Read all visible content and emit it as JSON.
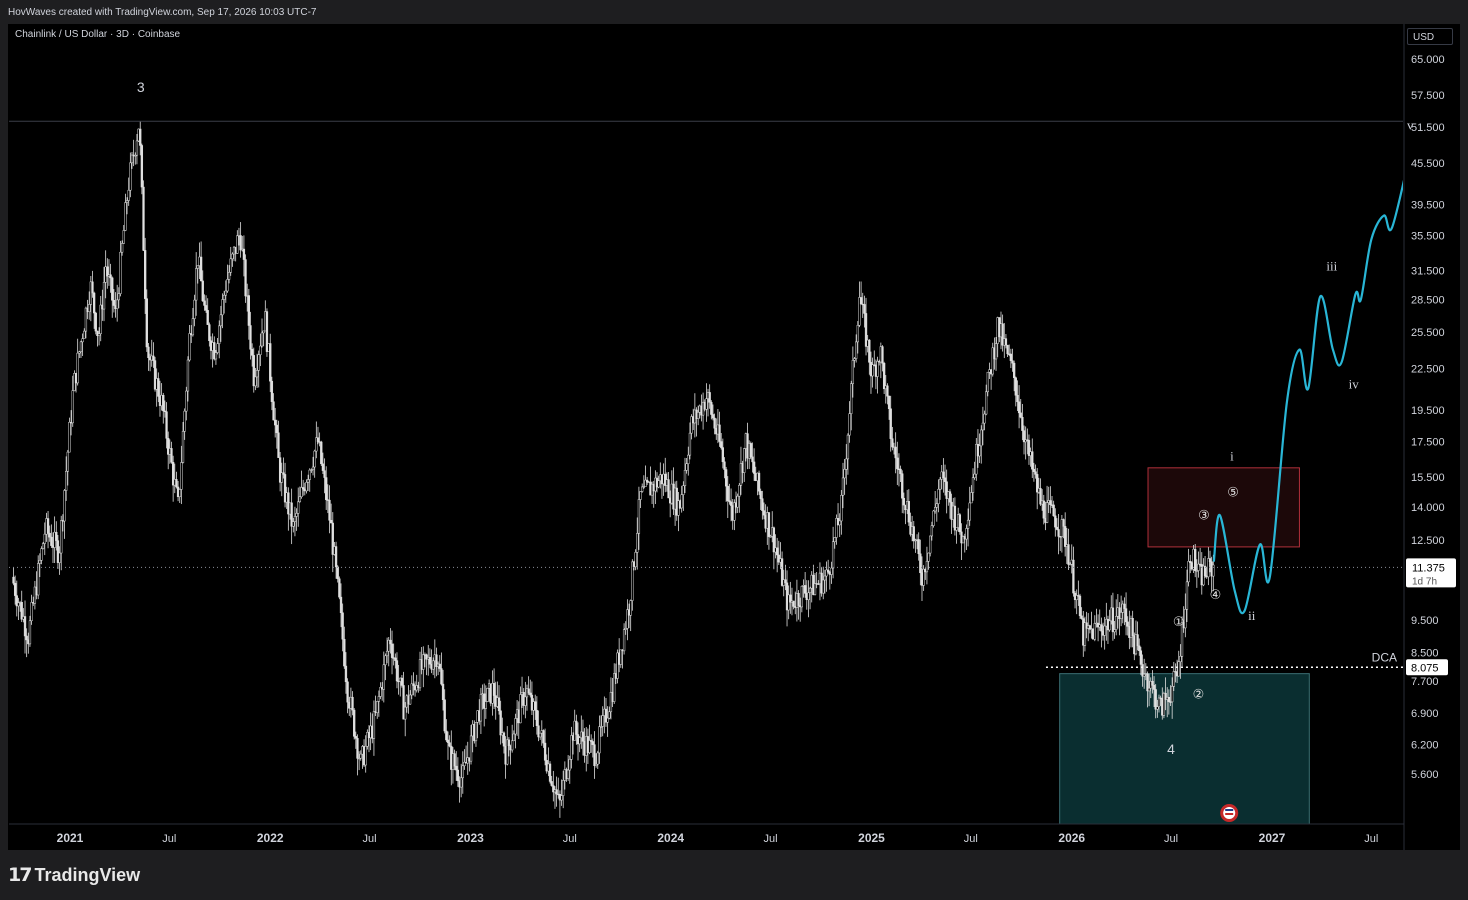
{
  "header": {
    "credit": "HovWaves created with TradingView.com, Sep 17, 2026 10:03 UTC-7"
  },
  "chart_title": "Chainlink / US Dollar · 3D · Coinbase",
  "currency_button": "USD",
  "logo": {
    "text": "TradingView",
    "icon": "tradingview-logo-icon"
  },
  "colors": {
    "background": "#000000",
    "frame": "#1e1e20",
    "candles": "#e0e0e0",
    "projection": "#29b6d6",
    "resistance_box": "#b0303a",
    "support_box": "#0e3d40",
    "text": "#d1d4dc"
  },
  "chart_data": {
    "type": "candlestick",
    "symbol": "Chainlink / US Dollar",
    "interval": "3D",
    "exchange": "Coinbase",
    "y_scale": "log",
    "ylim": [
      4.6,
      72
    ],
    "x_tick_labels": [
      "2021",
      "Jul",
      "2022",
      "Jul",
      "2023",
      "Jul",
      "2024",
      "Jul",
      "2025",
      "Jul",
      "2026",
      "Jul",
      "2027",
      "Jul"
    ],
    "y_tick_labels": [
      "65.000",
      "57.500",
      "51.500",
      "45.500",
      "39.500",
      "35.500",
      "31.500",
      "28.500",
      "25.500",
      "22.500",
      "19.500",
      "17.500",
      "15.500",
      "14.000",
      "12.500",
      "9.500",
      "8.500",
      "7.700",
      "6.900",
      "6.200",
      "5.600"
    ],
    "price_path": [
      [
        "2020-09-20",
        11.0
      ],
      [
        "2020-10-20",
        9.0
      ],
      [
        "2020-11-20",
        13.0
      ],
      [
        "2020-12-15",
        12.0
      ],
      [
        "2021-01-10",
        21.0
      ],
      [
        "2021-02-10",
        30.0
      ],
      [
        "2021-02-25",
        25.0
      ],
      [
        "2021-03-10",
        32.0
      ],
      [
        "2021-03-28",
        27.0
      ],
      [
        "2021-04-20",
        42.0
      ],
      [
        "2021-05-10",
        52.5
      ],
      [
        "2021-05-25",
        24.0
      ],
      [
        "2021-06-20",
        20.0
      ],
      [
        "2021-07-20",
        14.0
      ],
      [
        "2021-08-10",
        25.0
      ],
      [
        "2021-08-25",
        33.0
      ],
      [
        "2021-09-10",
        26.0
      ],
      [
        "2021-09-25",
        24.0
      ],
      [
        "2021-10-15",
        30.0
      ],
      [
        "2021-11-10",
        36.0
      ],
      [
        "2021-12-05",
        22.0
      ],
      [
        "2021-12-25",
        27.0
      ],
      [
        "2022-01-20",
        16.0
      ],
      [
        "2022-02-15",
        13.0
      ],
      [
        "2022-03-10",
        15.5
      ],
      [
        "2022-04-01",
        17.5
      ],
      [
        "2022-04-25",
        13.0
      ],
      [
        "2022-05-10",
        10.0
      ],
      [
        "2022-05-25",
        7.5
      ],
      [
        "2022-06-18",
        5.8
      ],
      [
        "2022-07-15",
        6.8
      ],
      [
        "2022-08-10",
        9.0
      ],
      [
        "2022-09-05",
        7.0
      ],
      [
        "2022-10-05",
        8.0
      ],
      [
        "2022-11-05",
        8.5
      ],
      [
        "2022-11-25",
        6.0
      ],
      [
        "2022-12-20",
        5.5
      ],
      [
        "2023-01-20",
        7.0
      ],
      [
        "2023-02-15",
        7.5
      ],
      [
        "2023-03-10",
        6.0
      ],
      [
        "2023-04-15",
        7.5
      ],
      [
        "2023-05-10",
        6.5
      ],
      [
        "2023-06-15",
        5.0
      ],
      [
        "2023-07-10",
        6.5
      ],
      [
        "2023-08-20",
        6.0
      ],
      [
        "2023-09-20",
        7.5
      ],
      [
        "2023-10-20",
        10.0
      ],
      [
        "2023-11-10",
        14.5
      ],
      [
        "2023-12-20",
        15.5
      ],
      [
        "2024-01-20",
        14.0
      ],
      [
        "2024-02-10",
        18.5
      ],
      [
        "2024-03-10",
        20.5
      ],
      [
        "2024-04-05",
        17.0
      ],
      [
        "2024-04-25",
        13.5
      ],
      [
        "2024-05-20",
        17.5
      ],
      [
        "2024-06-20",
        14.0
      ],
      [
        "2024-07-10",
        12.5
      ],
      [
        "2024-08-05",
        10.0
      ],
      [
        "2024-09-05",
        10.5
      ],
      [
        "2024-10-15",
        11.0
      ],
      [
        "2024-11-10",
        14.0
      ],
      [
        "2024-12-13",
        29.0
      ],
      [
        "2025-01-05",
        22.0
      ],
      [
        "2025-01-20",
        24.0
      ],
      [
        "2025-02-10",
        17.5
      ],
      [
        "2025-03-10",
        14.0
      ],
      [
        "2025-04-07",
        11.0
      ],
      [
        "2025-05-10",
        15.5
      ],
      [
        "2025-06-20",
        12.5
      ],
      [
        "2025-07-20",
        18.0
      ],
      [
        "2025-08-22",
        26.0
      ],
      [
        "2025-09-20",
        22.0
      ],
      [
        "2025-10-15",
        17.0
      ],
      [
        "2025-11-10",
        14.0
      ],
      [
        "2025-12-05",
        13.5
      ],
      [
        "2025-12-25",
        12.5
      ],
      [
        "2026-01-25",
        9.0
      ],
      [
        "2026-03-01",
        9.3
      ],
      [
        "2026-04-10",
        9.8
      ],
      [
        "2026-05-15",
        8.0
      ],
      [
        "2026-06-15",
        7.0
      ],
      [
        "2026-07-15",
        7.8
      ],
      [
        "2026-08-08",
        12.0
      ],
      [
        "2026-08-25",
        11.0
      ],
      [
        "2026-09-17",
        11.375
      ]
    ],
    "projection": [
      [
        "2026-09-17",
        11.6
      ],
      [
        "2026-09-28",
        13.6
      ],
      [
        "2026-10-25",
        10.5
      ],
      [
        "2026-11-12",
        9.8
      ],
      [
        "2026-12-10",
        12.3
      ],
      [
        "2026-12-28",
        11.0
      ],
      [
        "2027-01-28",
        20.0
      ],
      [
        "2027-02-20",
        24.0
      ],
      [
        "2027-03-08",
        21.0
      ],
      [
        "2027-03-30",
        28.8
      ],
      [
        "2027-04-22",
        24.0
      ],
      [
        "2027-05-08",
        23.0
      ],
      [
        "2027-06-02",
        29.0
      ],
      [
        "2027-06-12",
        28.5
      ],
      [
        "2027-07-01",
        35.0
      ],
      [
        "2027-07-24",
        38.0
      ],
      [
        "2027-08-08",
        36.5
      ],
      [
        "2027-09-12",
        48.0
      ]
    ],
    "wave_labels": {
      "primary": [
        {
          "label": "3",
          "x": "2021-05-10",
          "y": 58.0
        },
        {
          "label": "4",
          "x": "2026-07-01",
          "y": 6.0
        }
      ],
      "intermediate": [
        {
          "label": "i",
          "x": "2026-10-20",
          "y": 16.4
        },
        {
          "label": "ii",
          "x": "2026-11-25",
          "y": 9.5
        },
        {
          "label": "iii",
          "x": "2027-04-20",
          "y": 31.5
        },
        {
          "label": "iv",
          "x": "2027-05-30",
          "y": 21.0
        },
        {
          "label": "v",
          "x": "2027-09-10",
          "y": 51.0
        }
      ],
      "minor": [
        {
          "label": "①",
          "x": "2026-07-15",
          "y": 9.3
        },
        {
          "label": "②",
          "x": "2026-08-20",
          "y": 7.25
        },
        {
          "label": "③",
          "x": "2026-08-30",
          "y": 13.4
        },
        {
          "label": "④",
          "x": "2026-09-20",
          "y": 10.2
        },
        {
          "label": "⑤",
          "x": "2026-10-22",
          "y": 14.5
        }
      ]
    },
    "levels": {
      "current_price": "11.375",
      "countdown": "1d 7h",
      "dca_label": "DCA",
      "dca_price": "8.075"
    },
    "zones": {
      "resistance": {
        "x0": "2026-05-20",
        "x1": "2027-02-20",
        "y0": 12.2,
        "y1": 16.0
      },
      "support": {
        "x0": "2025-12-10",
        "x1": "2027-03-10",
        "y0": 4.6,
        "y1": 7.9
      }
    },
    "event_icon": {
      "name": "us-flag-event-icon",
      "x": "2026-10-15"
    }
  }
}
